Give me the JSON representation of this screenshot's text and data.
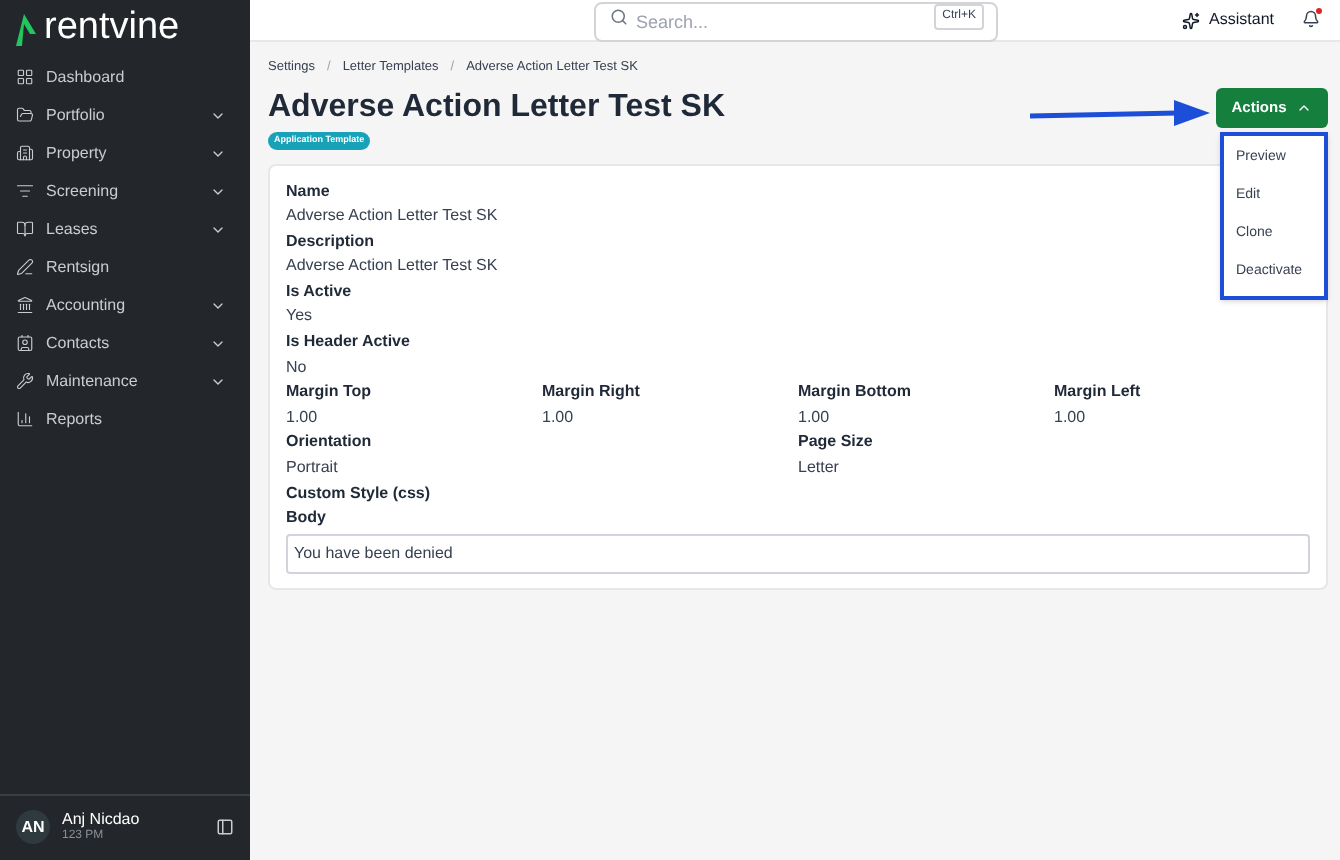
{
  "sidebar": {
    "logo": "rentvine",
    "items": [
      {
        "label": "Dashboard",
        "expandable": false
      },
      {
        "label": "Portfolio",
        "expandable": true
      },
      {
        "label": "Property",
        "expandable": true
      },
      {
        "label": "Screening",
        "expandable": true
      },
      {
        "label": "Leases",
        "expandable": true
      },
      {
        "label": "Rentsign",
        "expandable": false
      },
      {
        "label": "Accounting",
        "expandable": true
      },
      {
        "label": "Contacts",
        "expandable": true
      },
      {
        "label": "Maintenance",
        "expandable": true
      },
      {
        "label": "Reports",
        "expandable": false
      }
    ],
    "user": {
      "initials": "AN",
      "name": "Anj Nicdao",
      "time": "123 PM"
    }
  },
  "topbar": {
    "search": {
      "placeholder": "Search...",
      "shortcut": "Ctrl+K"
    },
    "assistant": "Assistant"
  },
  "breadcrumbs": [
    "Settings",
    "Letter Templates",
    "Adverse Action Letter Test SK"
  ],
  "breadcrumb_separator": "/",
  "title": "Adverse Action Letter Test SK",
  "badge": "Application Template",
  "actions": {
    "label": "Actions",
    "expanded": true,
    "menu": [
      "Preview",
      "Edit",
      "Clone",
      "Deactivate"
    ]
  },
  "fields": [
    {
      "cells": [
        {
          "label": "Name",
          "value": "Adverse Action Letter Test SK"
        }
      ]
    },
    {
      "cells": [
        {
          "label": "Description",
          "value": "Adverse Action Letter Test SK"
        }
      ]
    },
    {
      "cells": [
        {
          "label": "Is Active",
          "value": "Yes"
        }
      ]
    },
    {
      "cells": [
        {
          "label": "Is Header Active",
          "value": "No"
        }
      ]
    },
    {
      "cells": [
        {
          "label": "Margin Top",
          "value": "1.00"
        },
        {
          "label": "Margin Right",
          "value": "1.00"
        },
        {
          "label": "Margin Bottom",
          "value": "1.00"
        },
        {
          "label": "Margin Left",
          "value": "1.00"
        }
      ]
    },
    {
      "cells": [
        {
          "label": "Orientation",
          "value": "Portrait"
        },
        {
          "label": "Page Size",
          "value": "Letter"
        }
      ]
    },
    {
      "cells": [
        {
          "label": "Custom Style (css)"
        }
      ]
    },
    {
      "cells": [
        {
          "label": "Body",
          "value": "You have been denied",
          "kind": "box"
        }
      ]
    }
  ]
}
